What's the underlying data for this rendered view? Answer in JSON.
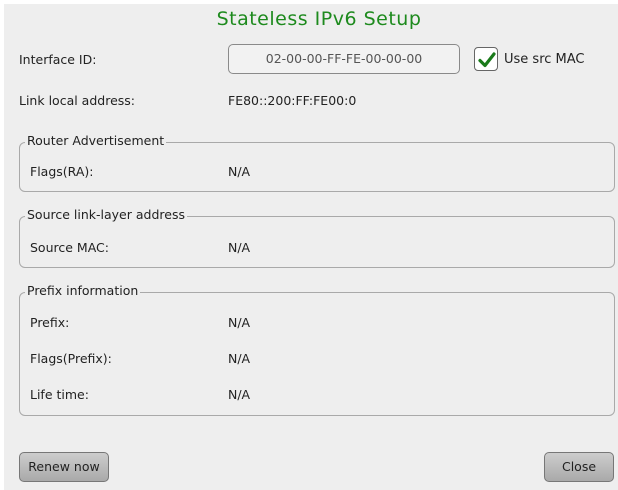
{
  "dialog": {
    "title": "Stateless IPv6 Setup"
  },
  "interface": {
    "id_label": "Interface ID:",
    "id_value": "02-00-00-FF-FE-00-00-00",
    "use_src_mac_label": "Use src MAC",
    "use_src_mac_checked": true
  },
  "link_local": {
    "label": "Link local address:",
    "value": "FE80::200:FF:FE00:0"
  },
  "router_adv": {
    "legend": "Router Advertisement",
    "flags_label": "Flags(RA):",
    "flags_value": "N/A"
  },
  "source_lla": {
    "legend": "Source link-layer address",
    "mac_label": "Source MAC:",
    "mac_value": "N/A"
  },
  "prefix_info": {
    "legend": "Prefix information",
    "prefix_label": "Prefix:",
    "prefix_value": "N/A",
    "flags_label": "Flags(Prefix):",
    "flags_value": "N/A",
    "lifetime_label": "Life time:",
    "lifetime_value": "N/A"
  },
  "buttons": {
    "renew": "Renew now",
    "close": "Close"
  },
  "icons": {
    "corner": "close-icon",
    "checkbox": "check-icon"
  },
  "colors": {
    "title": "#1d8a1d",
    "check": "#1a7a1a",
    "dialog_bg": "#eeeeee"
  }
}
